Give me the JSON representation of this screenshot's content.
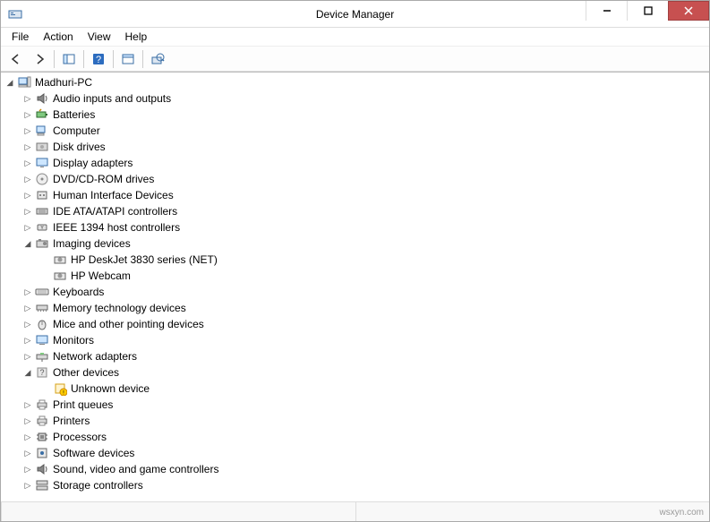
{
  "window": {
    "title": "Device Manager"
  },
  "menubar": [
    "File",
    "Action",
    "View",
    "Help"
  ],
  "tree": {
    "root": {
      "label": "Madhuri-PC",
      "expanded": true,
      "icon": "computer"
    },
    "items": [
      {
        "label": "Audio inputs and outputs",
        "icon": "audio",
        "expanded": false
      },
      {
        "label": "Batteries",
        "icon": "battery",
        "expanded": false
      },
      {
        "label": "Computer",
        "icon": "computer-cat",
        "expanded": false
      },
      {
        "label": "Disk drives",
        "icon": "disk",
        "expanded": false
      },
      {
        "label": "Display adapters",
        "icon": "display",
        "expanded": false
      },
      {
        "label": "DVD/CD-ROM drives",
        "icon": "dvd",
        "expanded": false
      },
      {
        "label": "Human Interface Devices",
        "icon": "hid",
        "expanded": false
      },
      {
        "label": "IDE ATA/ATAPI controllers",
        "icon": "ide",
        "expanded": false
      },
      {
        "label": "IEEE 1394 host controllers",
        "icon": "ieee1394",
        "expanded": false
      },
      {
        "label": "Imaging devices",
        "icon": "imaging",
        "expanded": true,
        "children": [
          {
            "label": "HP DeskJet 3830 series (NET)",
            "icon": "imaging-dev"
          },
          {
            "label": "HP Webcam",
            "icon": "imaging-dev"
          }
        ]
      },
      {
        "label": "Keyboards",
        "icon": "keyboard",
        "expanded": false
      },
      {
        "label": "Memory technology devices",
        "icon": "memory",
        "expanded": false
      },
      {
        "label": "Mice and other pointing devices",
        "icon": "mouse",
        "expanded": false
      },
      {
        "label": "Monitors",
        "icon": "monitor",
        "expanded": false
      },
      {
        "label": "Network adapters",
        "icon": "network",
        "expanded": false
      },
      {
        "label": "Other devices",
        "icon": "other",
        "expanded": true,
        "children": [
          {
            "label": "Unknown device",
            "icon": "unknown"
          }
        ]
      },
      {
        "label": "Print queues",
        "icon": "print",
        "expanded": false
      },
      {
        "label": "Printers",
        "icon": "printer",
        "expanded": false
      },
      {
        "label": "Processors",
        "icon": "cpu",
        "expanded": false
      },
      {
        "label": "Software devices",
        "icon": "software",
        "expanded": false
      },
      {
        "label": "Sound, video and game controllers",
        "icon": "sound",
        "expanded": false
      },
      {
        "label": "Storage controllers",
        "icon": "storage",
        "expanded": false
      }
    ]
  },
  "watermark": "wsxyn.com"
}
